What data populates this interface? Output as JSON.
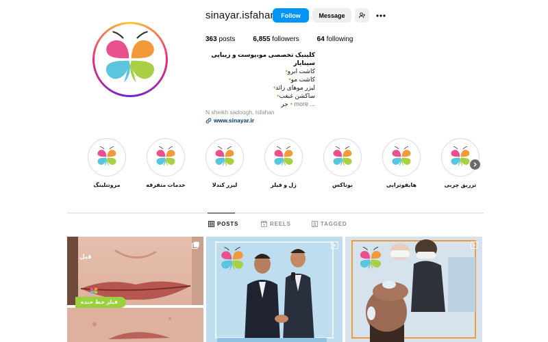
{
  "profile": {
    "username": "sinayar.isfahan",
    "follow_label": "Follow",
    "message_label": "Message",
    "stats": {
      "posts_count": "363",
      "posts_label": "posts",
      "followers_count": "6,855",
      "followers_label": "followers",
      "following_count": "64",
      "following_label": "following"
    },
    "bio": {
      "title": "کلینیک تخصصی مو،پوست و زیبایی سینایار",
      "lines": [
        "کاشت ابرو",
        "کاشت مو",
        "لیزر موهای زائد",
        "ساکشن غبغب"
      ],
      "truncated_line": "جر",
      "more_label": "... more",
      "location": "N sheikh sadoogh, Isfahan",
      "link": "www.sinayar.ir"
    }
  },
  "highlights": [
    {
      "label": "مزوتنلینگ"
    },
    {
      "label": "خدمات متفرقه"
    },
    {
      "label": "لیزر کندلا"
    },
    {
      "label": "ژل و فیلر"
    },
    {
      "label": "بوتاکس"
    },
    {
      "label": "هایفوتراپی"
    },
    {
      "label": "تزریق چربی"
    }
  ],
  "tabs": [
    {
      "label": "POSTS",
      "active": true
    },
    {
      "label": "REELS",
      "active": false
    },
    {
      "label": "TAGGED",
      "active": false
    }
  ],
  "posts": [
    {
      "type": "carousel",
      "before_label": "قبل",
      "banner": "فیلر خط خنده"
    },
    {
      "type": "reel",
      "logo_url_text": "www.sinayar.ir"
    },
    {
      "type": "reel",
      "logo_url_text": "www.sinayar.ir"
    }
  ],
  "colors": {
    "follow_blue": "#0095f6",
    "link_blue": "#00376b",
    "logo_pink": "#e9508e",
    "logo_orange": "#f29a3a",
    "logo_blue": "#5bc4df",
    "logo_green": "#a9cf45"
  },
  "icons": {
    "add_user": "add-user-icon",
    "more": "more-horizontal-icon",
    "link": "link-icon",
    "next": "chevron-right-icon",
    "posts_tab": "grid-icon",
    "reels_tab": "reels-icon",
    "tagged_tab": "tag-icon"
  }
}
